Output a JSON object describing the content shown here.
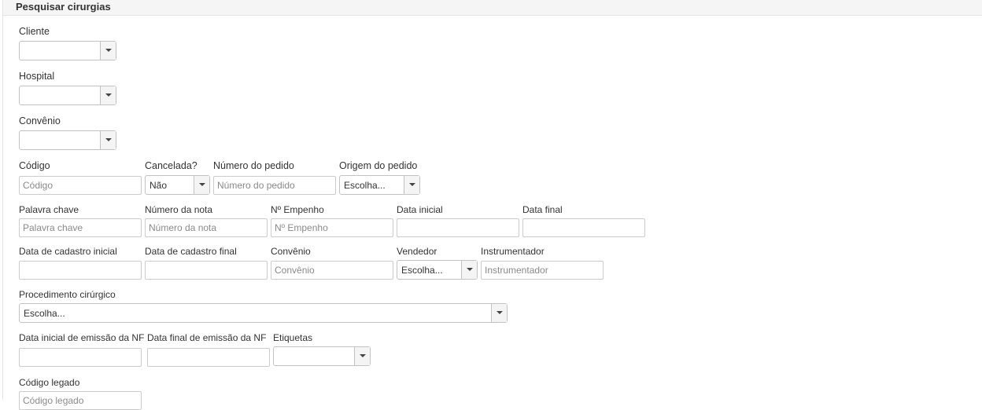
{
  "panel": {
    "title": "Pesquisar cirurgias"
  },
  "fields": {
    "cliente": {
      "label": "Cliente",
      "value": ""
    },
    "hospital": {
      "label": "Hospital",
      "value": ""
    },
    "convenio_select": {
      "label": "Convênio",
      "value": ""
    },
    "codigo": {
      "label": "Código",
      "placeholder": "Código"
    },
    "cancelada": {
      "label": "Cancelada?",
      "value": "Não"
    },
    "numero_pedido": {
      "label": "Número do pedido",
      "placeholder": "Número do pedido"
    },
    "origem_pedido": {
      "label": "Origem do pedido",
      "value": "Escolha..."
    },
    "palavra_chave": {
      "label": "Palavra chave",
      "placeholder": "Palavra chave"
    },
    "numero_nota": {
      "label": "Número da nota",
      "placeholder": "Número da nota"
    },
    "empenho": {
      "label": "Nº Empenho",
      "placeholder": "Nº Empenho"
    },
    "data_inicial": {
      "label": "Data inicial"
    },
    "data_final": {
      "label": "Data final"
    },
    "data_cadastro_inicial": {
      "label": "Data de cadastro inicial"
    },
    "data_cadastro_final": {
      "label": "Data de cadastro final"
    },
    "convenio_text": {
      "label": "Convênio",
      "placeholder": "Convênio"
    },
    "vendedor": {
      "label": "Vendedor",
      "value": "Escolha..."
    },
    "instrumentador": {
      "label": "Instrumentador",
      "placeholder": "Instrumentador"
    },
    "procedimento": {
      "label": "Procedimento cirúrgico",
      "value": "Escolha..."
    },
    "data_inicial_nf": {
      "label": "Data inicial de emissão da NF"
    },
    "data_final_nf": {
      "label": "Data final de emissão da NF"
    },
    "etiquetas": {
      "label": "Etiquetas",
      "value": ""
    },
    "codigo_legado": {
      "label": "Código legado",
      "placeholder": "Código legado"
    }
  }
}
